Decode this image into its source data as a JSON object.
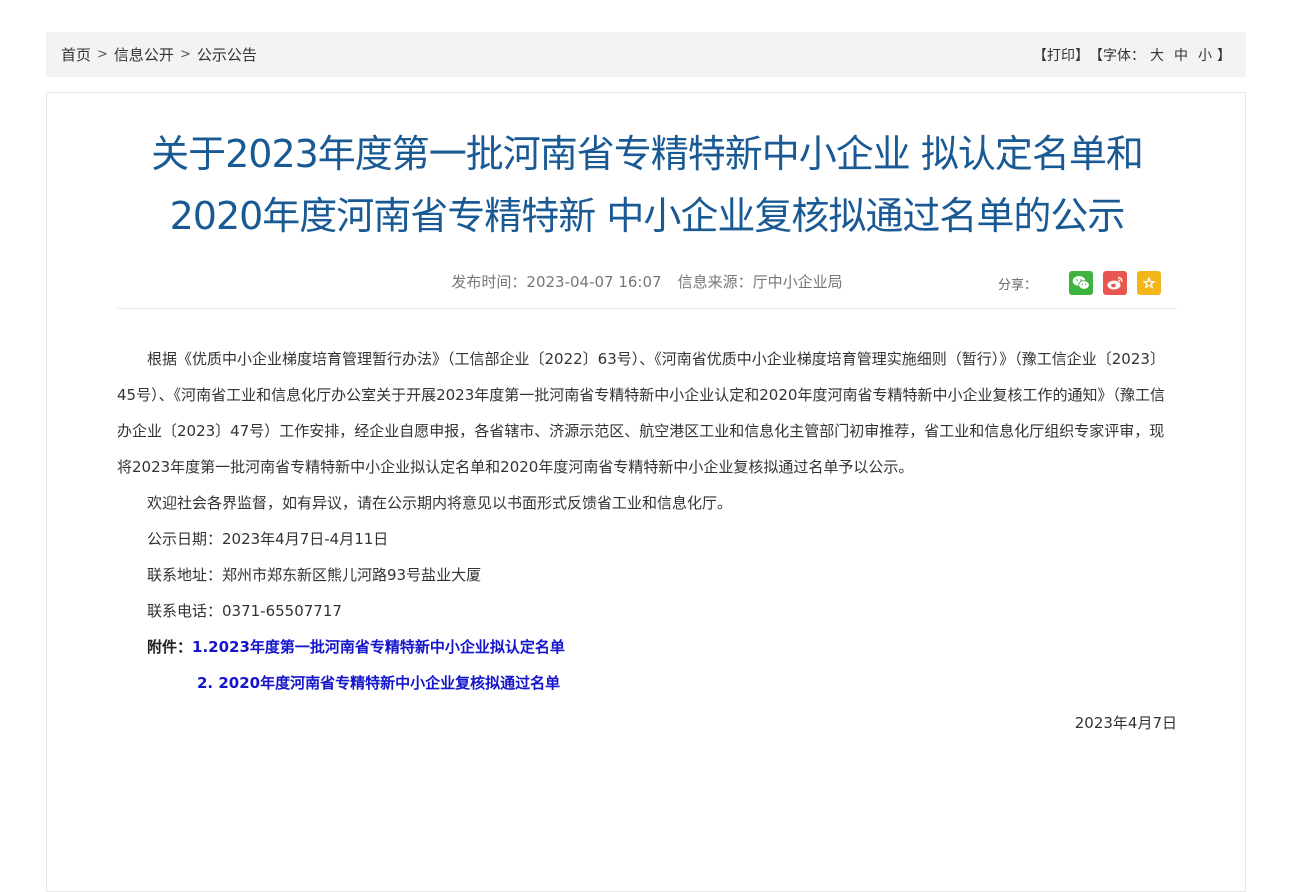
{
  "breadcrumb": {
    "home": "首页",
    "separator": ">",
    "level2": "信息公开",
    "level3": "公示公告"
  },
  "tools": {
    "print": "【打印】",
    "font_prefix": "【字体：",
    "font_large": "大",
    "font_medium": "中",
    "font_small": "小",
    "font_suffix": "】"
  },
  "article": {
    "title": "关于2023年度第一批河南省专精特新中小企业 拟认定名单和2020年度河南省专精特新 中小企业复核拟通过名单的公示",
    "publish_label": "发布时间：",
    "publish_time": "2023-04-07 16:07",
    "source_label": "信息来源：",
    "source": "厅中小企业局",
    "share_label": "分享：",
    "paragraphs": [
      "根据《优质中小企业梯度培育管理暂行办法》（工信部企业〔2022〕63号）、《河南省优质中小企业梯度培育管理实施细则（暂行）》（豫工信企业〔2023〕45号）、《河南省工业和信息化厅办公室关于开展2023年度第一批河南省专精特新中小企业认定和2020年度河南省专精特新中小企业复核工作的通知》（豫工信办企业〔2023〕47号）工作安排，经企业自愿申报，各省辖市、济源示范区、航空港区工业和信息化主管部门初审推荐，省工业和信息化厅组织专家评审，现将2023年度第一批河南省专精特新中小企业拟认定名单和2020年度河南省专精特新中小企业复核拟通过名单予以公示。",
      "欢迎社会各界监督，如有异议，请在公示期内将意见以书面形式反馈省工业和信息化厅。",
      "公示日期：2023年4月7日-4月11日",
      "联系地址：郑州市郑东新区熊儿河路93号盐业大厦",
      "联系电话：0371-65507717"
    ],
    "attachment_label": "附件：",
    "attachments": [
      "1.2023年度第一批河南省专精特新中小企业拟认定名单",
      "2. 2020年度河南省专精特新中小企业复核拟通过名单"
    ],
    "date": "2023年4月7日"
  },
  "icons": {
    "wechat": "wechat-icon",
    "weibo": "weibo-icon",
    "favorite": "star-icon"
  },
  "colors": {
    "title": "#1a5a94",
    "link": "#1515cc",
    "wechat": "#3fb33f",
    "weibo": "#e8574f",
    "favorite": "#f3b41c"
  }
}
